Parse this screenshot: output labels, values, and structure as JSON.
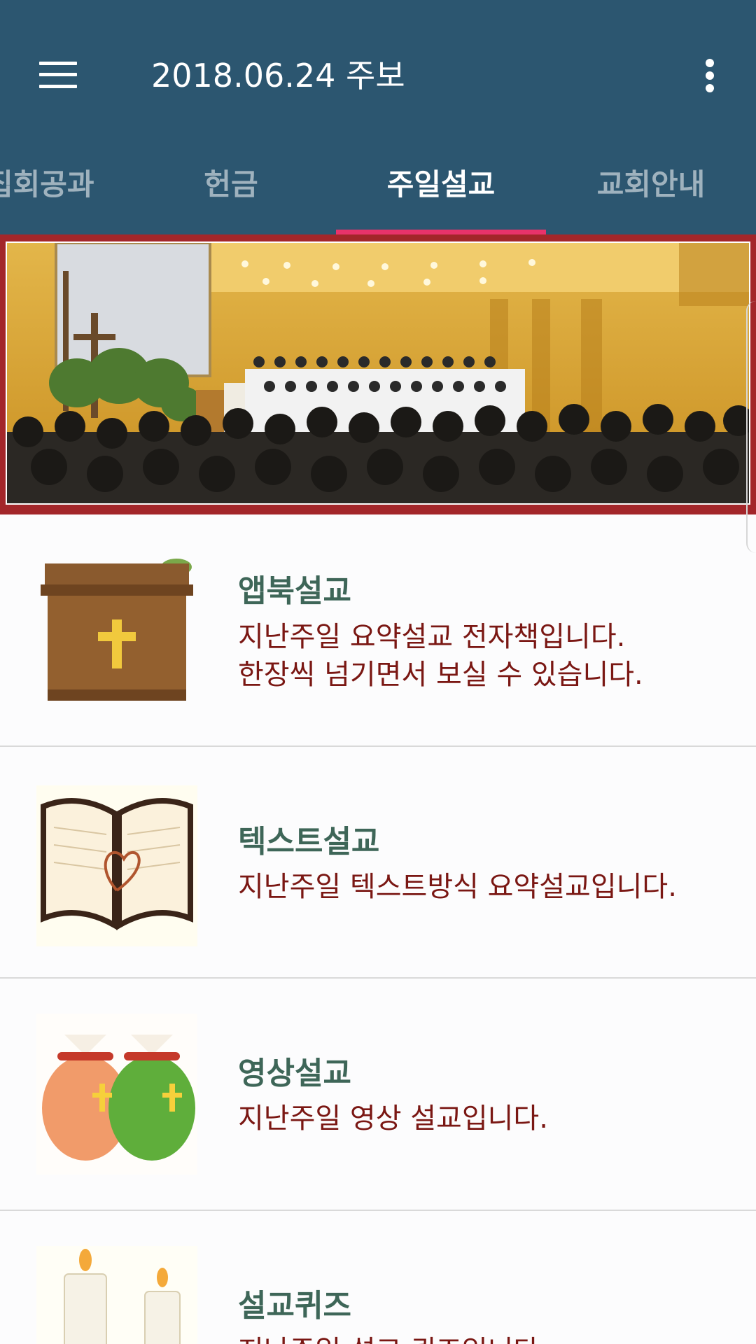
{
  "app_bar": {
    "title": "2018.06.24 주보",
    "menu_icon": "hamburger-menu-icon",
    "overflow_icon": "more-vertical-icon",
    "background_color": "#2c5670"
  },
  "tabs": [
    {
      "label": "집회공과",
      "active": false
    },
    {
      "label": "헌금",
      "active": false
    },
    {
      "label": "주일설교",
      "active": true
    },
    {
      "label": "교회안내",
      "active": false
    }
  ],
  "tab_indicator_color": "#e8336b",
  "banner": {
    "image": "church-worship-service-photo",
    "frame_color": "#a3262a"
  },
  "items": [
    {
      "title": "앱북설교",
      "desc_line1": "지난주일 요약설교 전자책입니다.",
      "desc_line2": "한장씩 넘기면서 보실 수 있습니다.",
      "icon": "pulpit-cross-icon"
    },
    {
      "title": "텍스트설교",
      "desc_line1": "지난주일 텍스트방식 요약설교입니다.",
      "icon": "open-bible-icon"
    },
    {
      "title": "영상설교",
      "desc_line1": "지난주일 영상 설교입니다.",
      "icon": "gift-pouch-icon"
    },
    {
      "title": "설교퀴즈",
      "desc_line1": "지난주일 설교 퀴즈입니다.",
      "icon": "candles-icon"
    }
  ],
  "colors": {
    "item_title": "#3e6658",
    "item_desc": "#7a1713",
    "divider": "#d9d9d9"
  }
}
